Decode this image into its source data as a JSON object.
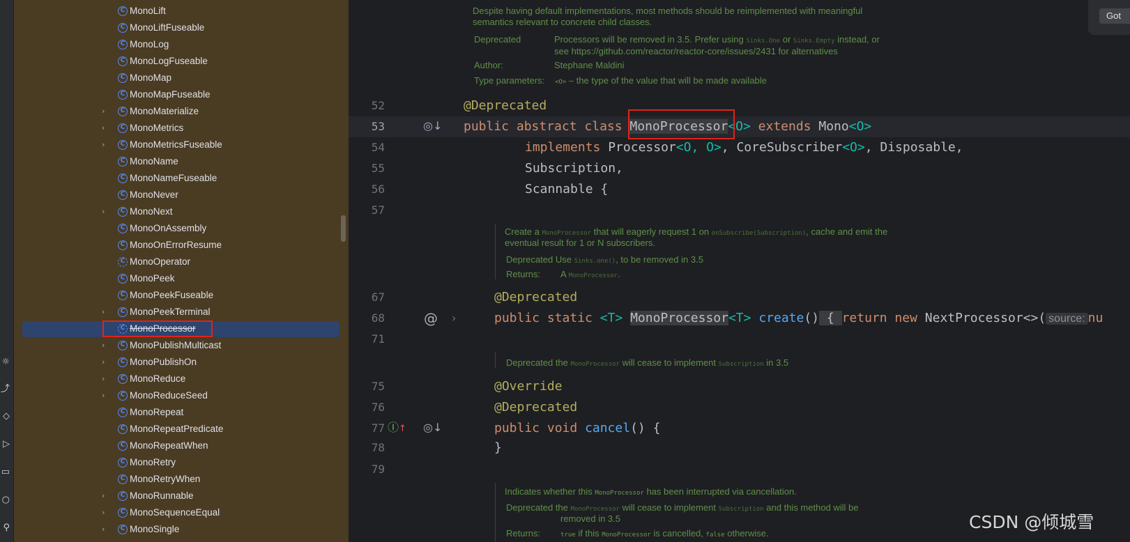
{
  "tree": {
    "items": [
      {
        "label": "MonoLift",
        "expandable": false
      },
      {
        "label": "MonoLiftFuseable",
        "expandable": false
      },
      {
        "label": "MonoLog",
        "expandable": false
      },
      {
        "label": "MonoLogFuseable",
        "expandable": false
      },
      {
        "label": "MonoMap",
        "expandable": false
      },
      {
        "label": "MonoMapFuseable",
        "expandable": false
      },
      {
        "label": "MonoMaterialize",
        "expandable": true
      },
      {
        "label": "MonoMetrics",
        "expandable": true
      },
      {
        "label": "MonoMetricsFuseable",
        "expandable": true
      },
      {
        "label": "MonoName",
        "expandable": false
      },
      {
        "label": "MonoNameFuseable",
        "expandable": false
      },
      {
        "label": "MonoNever",
        "expandable": false
      },
      {
        "label": "MonoNext",
        "expandable": true
      },
      {
        "label": "MonoOnAssembly",
        "expandable": false
      },
      {
        "label": "MonoOnErrorResume",
        "expandable": false
      },
      {
        "label": "MonoOperator",
        "expandable": false,
        "abstract": true
      },
      {
        "label": "MonoPeek",
        "expandable": false
      },
      {
        "label": "MonoPeekFuseable",
        "expandable": false
      },
      {
        "label": "MonoPeekTerminal",
        "expandable": true
      },
      {
        "label": "MonoProcessor",
        "expandable": false,
        "abstract": true,
        "selected": true,
        "deprecated": true
      },
      {
        "label": "MonoPublishMulticast",
        "expandable": true
      },
      {
        "label": "MonoPublishOn",
        "expandable": true
      },
      {
        "label": "MonoReduce",
        "expandable": true
      },
      {
        "label": "MonoReduceSeed",
        "expandable": true
      },
      {
        "label": "MonoRepeat",
        "expandable": false
      },
      {
        "label": "MonoRepeatPredicate",
        "expandable": false
      },
      {
        "label": "MonoRepeatWhen",
        "expandable": false
      },
      {
        "label": "MonoRetry",
        "expandable": false
      },
      {
        "label": "MonoRetryWhen",
        "expandable": false
      },
      {
        "label": "MonoRunnable",
        "expandable": true
      },
      {
        "label": "MonoSequenceEqual",
        "expandable": true
      },
      {
        "label": "MonoSingle",
        "expandable": true
      }
    ],
    "class_icon_glyph": "C",
    "expand_glyph": "›"
  },
  "toolstrip": {
    "icons": [
      "bug-icon",
      "git-icon",
      "services-icon",
      "run-icon",
      "terminal-icon",
      "problems-icon",
      "endpoints-icon"
    ],
    "glyphs": [
      "☼",
      "⤴",
      "◇",
      "▷",
      "▭",
      "○",
      "⚲"
    ]
  },
  "editor": {
    "doc_class": {
      "description_1": "Despite having default implementations, most methods should be reimplemented with meaningful",
      "description_2": "semantics relevant to concrete child classes.",
      "deprecated_key": "Deprecated",
      "deprecated_text_1a": "Processors will be removed in 3.5. Prefer using",
      "deprecated_code_1": "Sinks.One",
      "deprecated_text_1b": "or",
      "deprecated_code_2": "Sinks.Empty",
      "deprecated_text_1c": "instead, or",
      "deprecated_text_2": "see https://github.com/reactor/reactor-core/issues/2431 for alternatives",
      "author_key": "Author:",
      "author_value": "Stephane Maldini",
      "type_params_key": "Type parameters:",
      "type_params_code": "<O>",
      "type_params_text": " – the type of the value that will be made available"
    },
    "lines": {
      "n52": "52",
      "n53": "53",
      "n54": "54",
      "n55": "55",
      "n56": "56",
      "n57": "57",
      "n67": "67",
      "n68": "68",
      "n71": "71",
      "n75": "75",
      "n76": "76",
      "n77": "77",
      "n78": "78",
      "n79": "79"
    },
    "code": {
      "l52": "@Deprecated",
      "l53_kw": "public abstract class ",
      "l53_name": "MonoProcessor",
      "l53_tp1": "<O>",
      "l53_ext": " extends ",
      "l53_mono": "Mono",
      "l53_tp2": "<O>",
      "l54_kw": "implements ",
      "l54_a": "Processor",
      "l54_tp": "<O, O>",
      "l54_b": ", CoreSubscriber",
      "l54_tp2": "<O>",
      "l54_c": ", Disposable,",
      "l55": "Subscription,",
      "l56": "Scannable {",
      "l67": "@Deprecated",
      "l68_kw": "public static ",
      "l68_t1": "<T>",
      "l68_name": "MonoProcessor",
      "l68_t2": "<T>",
      "l68_fn": "create",
      "l68_paren": "()",
      "l68_brace": " { ",
      "l68_kw2": "return new ",
      "l68_np": "NextProcessor<>(",
      "l68_hint": "source:",
      "l68_null": "nu",
      "l75": "@Override",
      "l76": "@Deprecated",
      "l77_kw": "public void ",
      "l77_fn": "cancel",
      "l77_rest": "() {",
      "l78": "}"
    },
    "doc_create": {
      "text_a": "Create a",
      "code_a": "MonoProcessor",
      "text_b": "that will eagerly request 1 on",
      "code_b": "onSubscribe(Subscription)",
      "text_c": ", cache and emit the",
      "line2": "eventual result for 1 or N subscribers.",
      "dep_a": "Deprecated Use",
      "dep_code": "Sinks.one()",
      "dep_b": ", to be removed in 3.5",
      "returns_key": "Returns:",
      "returns_a": "A",
      "returns_code": "MonoProcessor",
      "returns_b": "."
    },
    "doc_cancel": {
      "text_a": "Deprecated the",
      "code_a": "MonoProcessor",
      "text_b": "will cease to implement",
      "code_b": "Subscription",
      "text_c": "in 3.5"
    },
    "doc_disposed": {
      "text_a": "Indicates whether this",
      "code_a": "MonoProcessor",
      "text_b": "has been interrupted via cancellation.",
      "dep_a": "Deprecated the",
      "dep_code_a": "MonoProcessor",
      "dep_b": "will cease to implement",
      "dep_code_b": "Subscription",
      "dep_c": "and this method will be",
      "dep_line2": "removed in 3.5",
      "returns_key": "Returns:",
      "returns_code_a": "true",
      "returns_a": "if this",
      "returns_code_b": "MonoProcessor",
      "returns_b": "is cancelled,",
      "returns_code_c": "false",
      "returns_c": "otherwise."
    }
  },
  "notification": {
    "button_label": "Got"
  },
  "watermark": "CSDN @倾城雪"
}
